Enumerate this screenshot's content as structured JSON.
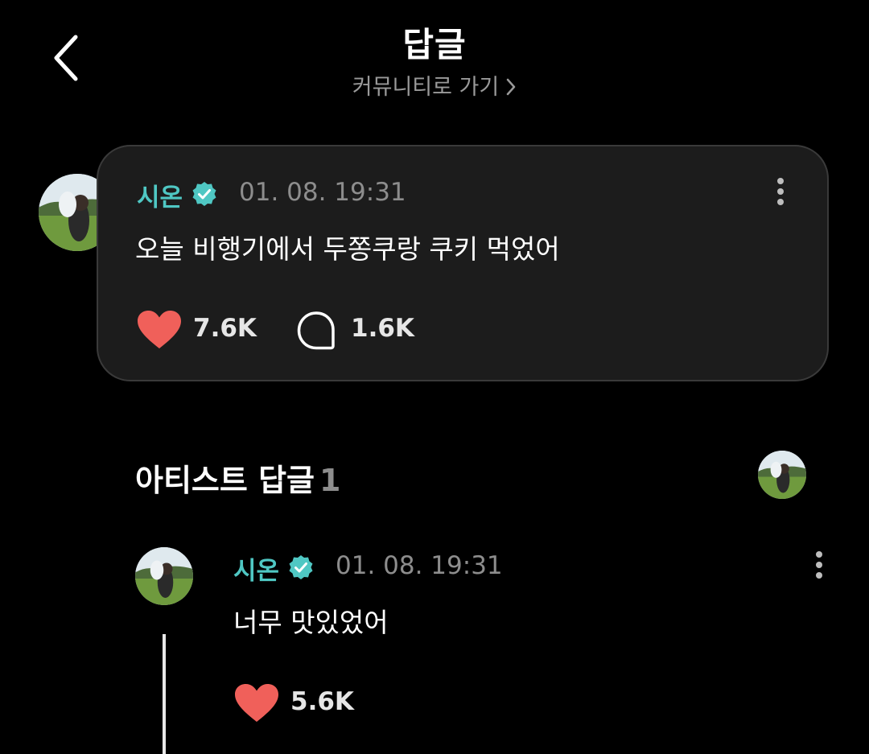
{
  "header": {
    "title": "답글",
    "community_link": "커뮤니티로 가기"
  },
  "post": {
    "author": "시온",
    "timestamp": "01. 08. 19:31",
    "text": "오늘 비행기에서 두쫑쿠랑 쿠키 먹었어",
    "likes": "7.6K",
    "comments": "1.6K"
  },
  "artist_replies": {
    "title": "아티스트 답글",
    "count": "1"
  },
  "reply": {
    "author": "시온",
    "timestamp": "01. 08. 19:31",
    "text": "너무 맛있었어",
    "likes": "5.6K"
  },
  "colors": {
    "accent": "#4fc7c3",
    "heart": "#f0605a",
    "card_bg": "#1c1c1c",
    "muted": "#8d8d8d"
  },
  "icons": {
    "back": "chevron-left-icon",
    "link": "chevron-right-icon",
    "verified": "verified-badge-icon",
    "like": "heart-icon",
    "comment": "speech-bubble-icon",
    "more": "more-vertical-icon"
  }
}
